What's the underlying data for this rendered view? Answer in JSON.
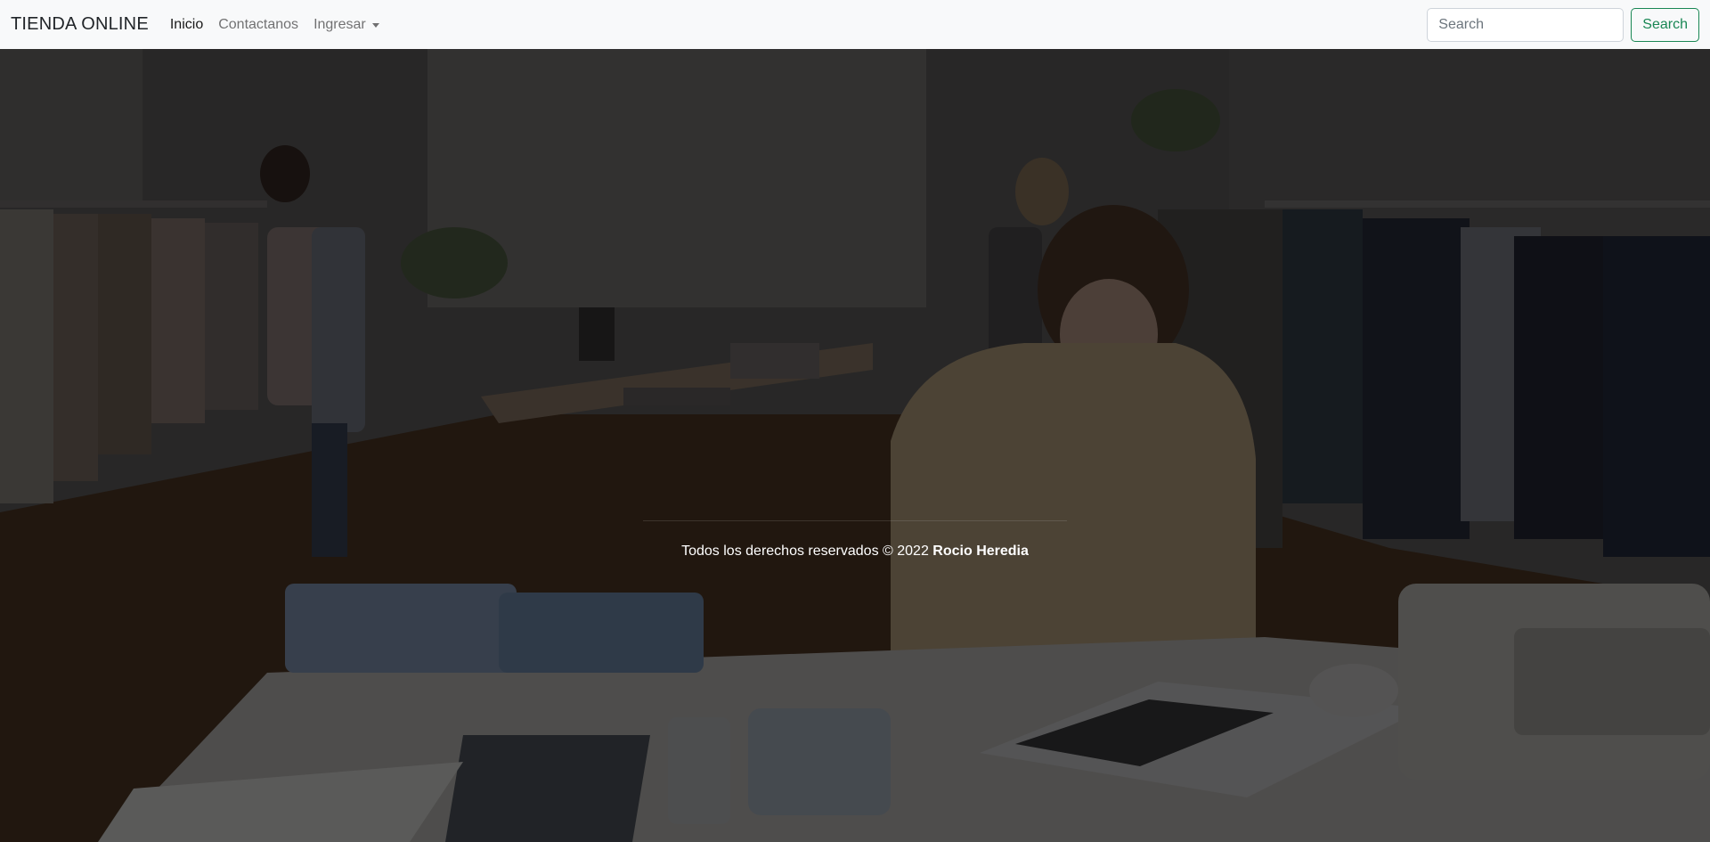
{
  "navbar": {
    "brand": "TIENDA ONLINE",
    "links": [
      {
        "label": "Inicio",
        "active": true
      },
      {
        "label": "Contactanos",
        "active": false
      },
      {
        "label": "Ingresar",
        "active": false,
        "dropdown": true
      }
    ],
    "search": {
      "placeholder": "Search",
      "value": "",
      "button_label": "Search"
    }
  },
  "hero": {
    "background": "photo of a clothing store interior with woman working on laptop",
    "footer": {
      "text": "Todos los derechos reservados © 2022",
      "author": "Rocio Heredia"
    }
  },
  "colors": {
    "navbar_bg": "#f8f9fa",
    "search_button": "#198754",
    "footer_text": "#ffffff"
  }
}
